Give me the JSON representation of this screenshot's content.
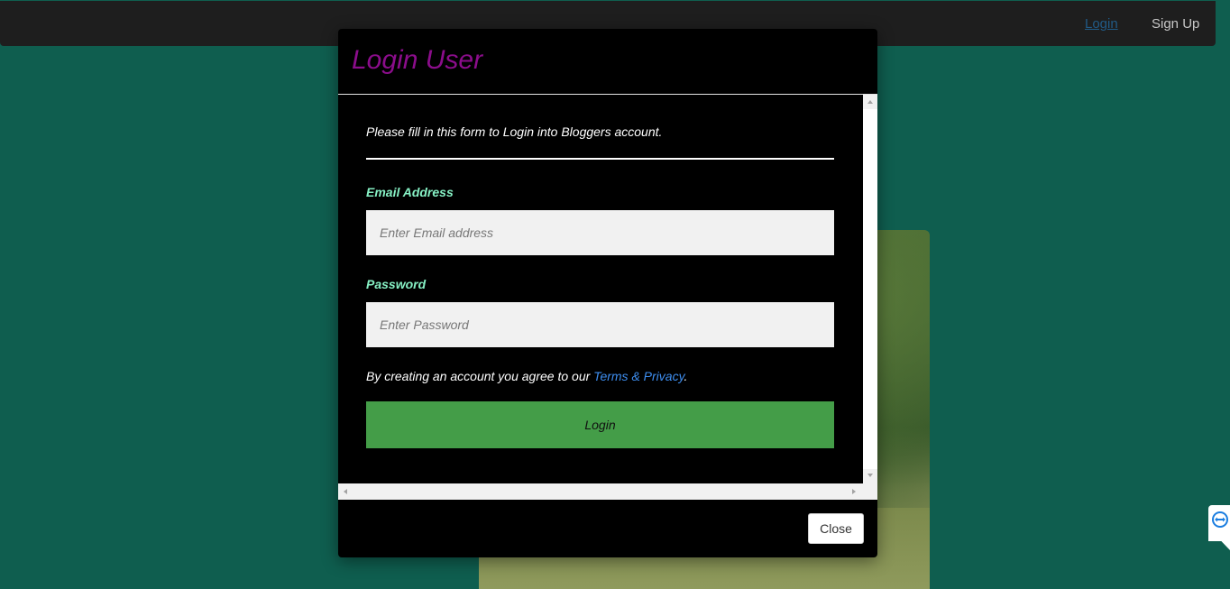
{
  "navbar": {
    "login_label": "Login",
    "signup_label": "Sign Up"
  },
  "modal": {
    "title": "Login User",
    "intro": "Please fill in this form to Login into Bloggers account.",
    "email": {
      "label": "Email Address",
      "placeholder": "Enter Email address",
      "value": ""
    },
    "password": {
      "label": "Password",
      "placeholder": "Enter Password",
      "value": ""
    },
    "terms": {
      "prefix": "By creating an account you agree to our ",
      "link": "Terms & Privacy",
      "suffix": "."
    },
    "login_button": "Login",
    "close_button": "Close"
  },
  "icons": {
    "remote_support": "teamviewer-icon"
  },
  "colors": {
    "page_background": "#0f5e4f",
    "navbar": "#1e1e1e",
    "modal_title": "#8b0d8b",
    "field_label": "#86f0c4",
    "link": "#3e8ef0",
    "login_button": "#449d48"
  }
}
